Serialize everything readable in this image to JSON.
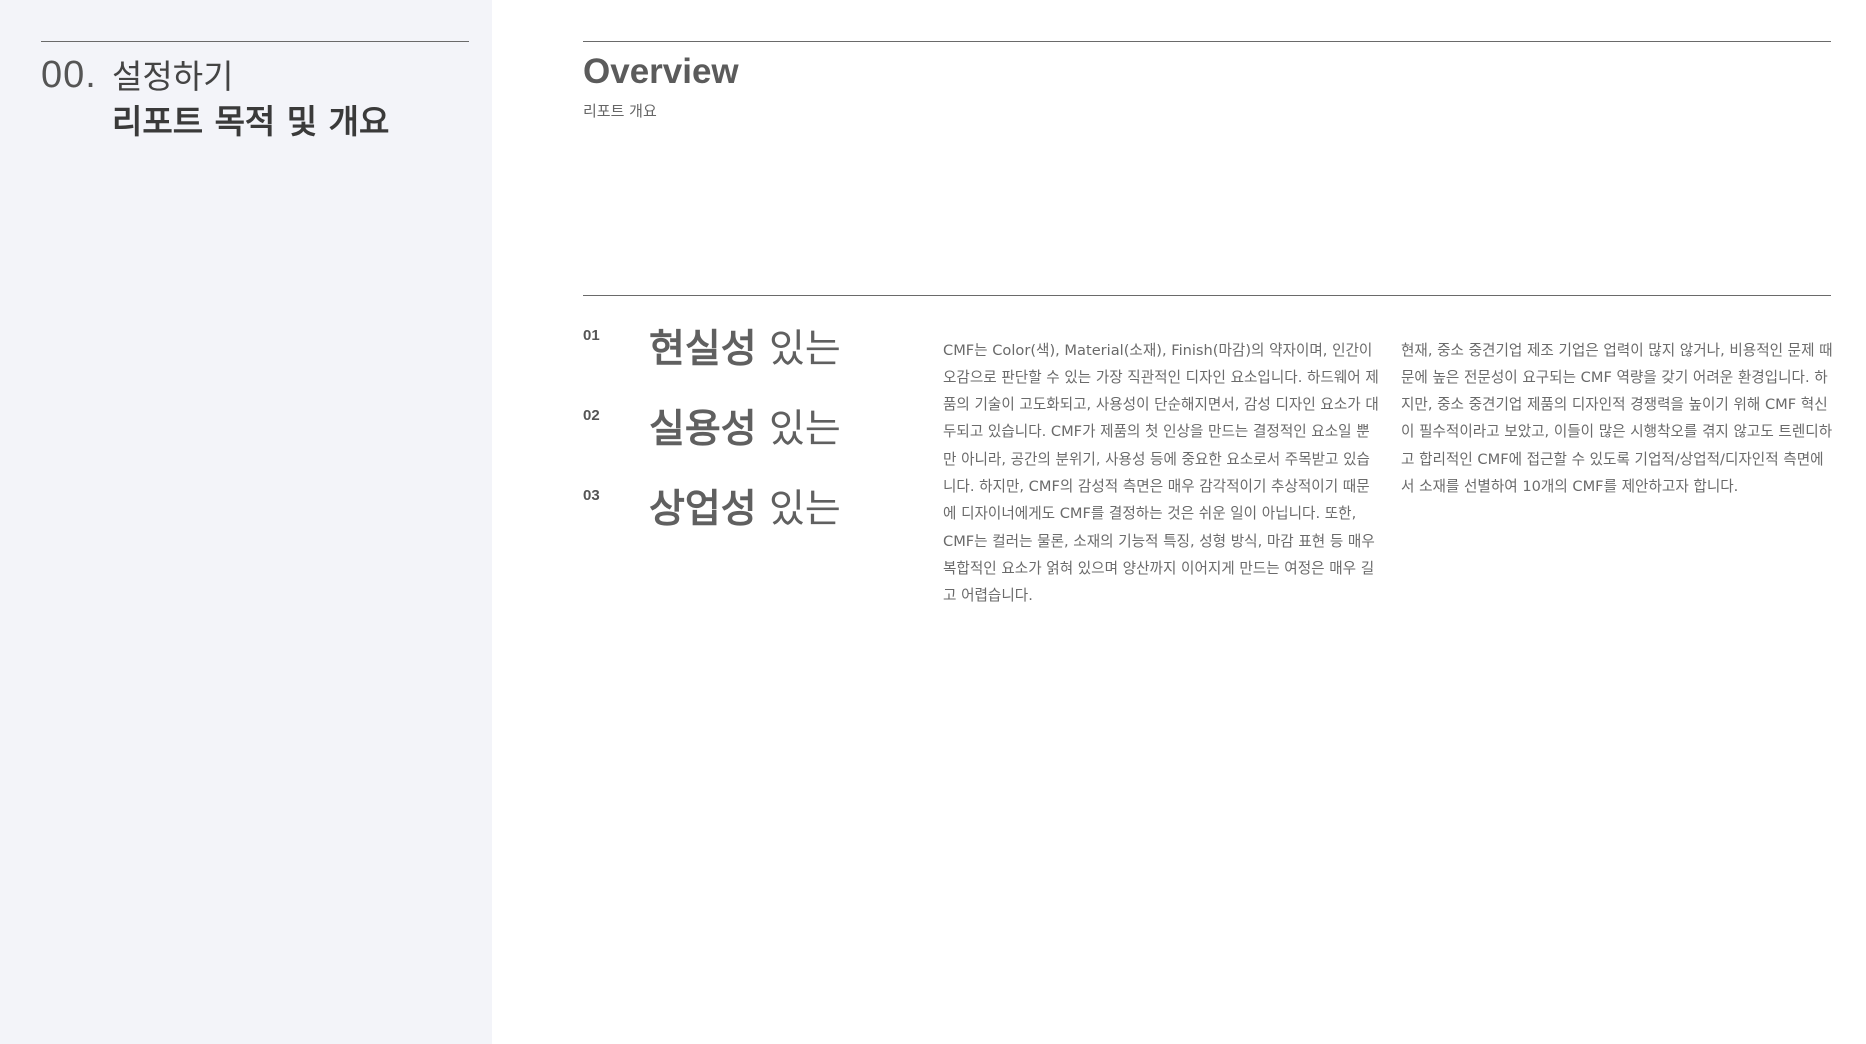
{
  "sidebar": {
    "section_number": "00.",
    "title_line1": "설정하기",
    "title_line2": "리포트 목적 및 개요"
  },
  "overview": {
    "title": "Overview",
    "subtitle": "리포트 개요"
  },
  "points": [
    {
      "number": "01",
      "strong": "현실성",
      "light": " 있는"
    },
    {
      "number": "02",
      "strong": "실용성",
      "light": " 있는"
    },
    {
      "number": "03",
      "strong": "상업성",
      "light": " 있는"
    }
  ],
  "paragraphs": [
    "CMF는 Color(색), Material(소재), Finish(마감)의 약자이며, 인간이 오감으로 판단할 수 있는 가장 직관적인 디자인 요소입니다. 하드웨어 제품의 기술이 고도화되고, 사용성이 단순해지면서, 감성 디자인 요소가 대두되고 있습니다. CMF가 제품의 첫 인상을 만드는 결정적인 요소일 뿐만 아니라, 공간의 분위기, 사용성 등에 중요한 요소로서 주목받고 있습니다. 하지만, CMF의 감성적 측면은 매우 감각적이기 추상적이기 때문에 디자이너에게도 CMF를 결정하는 것은 쉬운 일이 아닙니다. 또한, CMF는 컬러는 물론, 소재의 기능적 특징, 성형 방식, 마감 표현 등 매우 복합적인 요소가 얽혀 있으며 양산까지 이어지게 만드는 여정은 매우 길고 어렵습니다.",
    "현재, 중소 중견기업 제조 기업은 업력이 많지 않거나, 비용적인 문제 때문에 높은 전문성이 요구되는 CMF 역량을 갖기 어려운 환경입니다. 하지만, 중소 중견기업 제품의 디자인적 경쟁력을 높이기 위해 CMF 혁신이 필수적이라고 보았고, 이들이 많은 시행착오를 겪지 않고도 트렌디하고 합리적인 CMF에 접근할 수 있도록 기업적/상업적/디자인적 측면에서 소재를 선별하여 10개의 CMF를 제안하고자 합니다."
  ]
}
